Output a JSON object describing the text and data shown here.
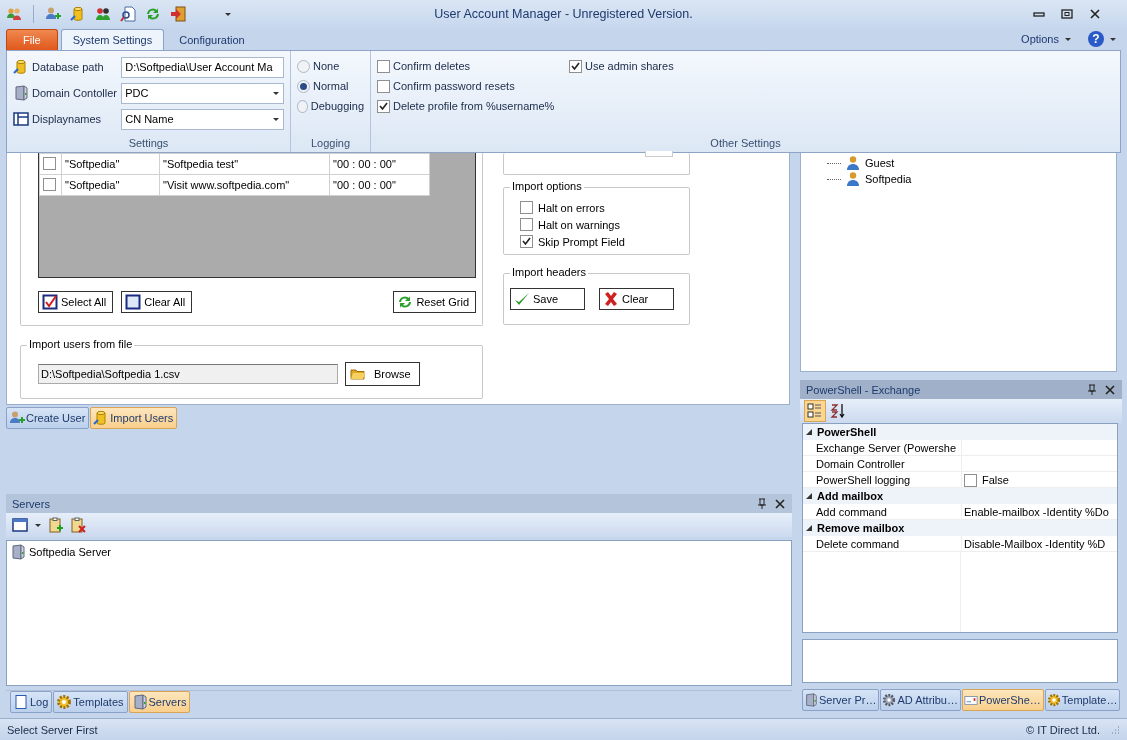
{
  "window": {
    "title": "User Account Manager - Unregistered Version."
  },
  "ribbon": {
    "tabs": [
      {
        "label": "File",
        "kind": "file",
        "selected": false
      },
      {
        "label": "System Settings",
        "kind": "page",
        "selected": true
      },
      {
        "label": "Configuration",
        "kind": "page",
        "selected": false
      }
    ],
    "options": "Options",
    "help": "?",
    "settings": {
      "caption": "Settings",
      "fields": [
        {
          "label": "Database path",
          "kind": "text",
          "value": "D:\\Softpedia\\User Account Ma"
        },
        {
          "label": "Domain Contoller",
          "kind": "dropdown",
          "value": "PDC"
        },
        {
          "label": "Displaynames",
          "kind": "dropdown",
          "value": "CN Name"
        }
      ]
    },
    "logging": {
      "caption": "Logging",
      "options": [
        {
          "label": "None",
          "selected": false
        },
        {
          "label": "Normal",
          "selected": true
        },
        {
          "label": "Debugging",
          "selected": false
        }
      ]
    },
    "other": {
      "caption": "Other Settings",
      "checks": [
        {
          "label": "Confirm deletes",
          "checked": false
        },
        {
          "label": "Confirm password resets",
          "checked": false
        },
        {
          "label": "Delete profile from %username%",
          "checked": true
        },
        {
          "label": "Use admin shares",
          "checked": true
        }
      ]
    }
  },
  "import": {
    "grid_rows": [
      {
        "checked": false,
        "cells": [
          "\"Softpedia\"",
          "\"Softpedia test\"",
          "\"00 : 00 : 00\""
        ]
      },
      {
        "checked": false,
        "cells": [
          "\"Softpedia\"",
          "\"Visit www.softpedia.com\"",
          "\"00 : 00 : 00\""
        ]
      }
    ],
    "grid_buttons": [
      {
        "label": "Select All",
        "kind": "checked-box"
      },
      {
        "label": "Clear All",
        "kind": "empty-box"
      },
      {
        "label": "Reset Grid",
        "kind": "refresh"
      }
    ],
    "import_options": {
      "title": "Import options",
      "items": [
        {
          "label": "Halt on errors",
          "checked": false
        },
        {
          "label": "Halt on warnings",
          "checked": false
        },
        {
          "label": "Skip Prompt Field",
          "checked": true
        }
      ]
    },
    "import_headers": {
      "title": "Import headers",
      "buttons": [
        {
          "label": "Save",
          "kind": "check"
        },
        {
          "label": "Clear",
          "kind": "cross"
        }
      ]
    },
    "file": {
      "title": "Import users from file",
      "value": "D:\\Softpedia\\Softpedia 1.csv",
      "button": "Browse"
    }
  },
  "doc_tabs": [
    {
      "label": "Create User",
      "kind": "add-user",
      "selected": false
    },
    {
      "label": "Import Users",
      "kind": "database",
      "selected": true
    }
  ],
  "servers": {
    "title": "Servers",
    "items": [
      {
        "label": "Softpedia Server"
      }
    ],
    "tabs": [
      {
        "label": "Log",
        "kind": "log",
        "selected": false
      },
      {
        "label": "Templates",
        "kind": "gear",
        "selected": false
      },
      {
        "label": "Servers",
        "kind": "server",
        "selected": true
      }
    ]
  },
  "user_tree": {
    "items": [
      {
        "label": "Guest"
      },
      {
        "label": "Softpedia"
      }
    ]
  },
  "powershell": {
    "title": "PowerShell - Exchange",
    "categories": [
      {
        "name": "PowerShell",
        "expanded": true,
        "rows": [
          {
            "name": "Exchange Server (Powershe",
            "kind": "text"
          },
          {
            "name": "Domain Controller",
            "kind": "text"
          },
          {
            "name": "PowerShell logging",
            "kind": "checkbox",
            "checked": false,
            "value": "False"
          }
        ]
      },
      {
        "name": "Add mailbox",
        "expanded": true,
        "rows": [
          {
            "name": "Add command",
            "kind": "text",
            "value": "Enable-mailbox -Identity %Do"
          }
        ]
      },
      {
        "name": "Remove mailbox",
        "expanded": true,
        "rows": [
          {
            "name": "Delete command",
            "kind": "text",
            "value": "Disable-Mailbox -Identity %D"
          }
        ]
      }
    ],
    "tabs": [
      {
        "label": "Server Pr…",
        "kind": "server",
        "selected": false
      },
      {
        "label": "AD Attribu…",
        "kind": "gear-grey",
        "selected": false
      },
      {
        "label": "PowerShe…",
        "kind": "card",
        "selected": true
      },
      {
        "label": "Template…",
        "kind": "gear",
        "selected": false
      }
    ]
  },
  "status_bar": {
    "left": "Select Server First",
    "right": "© IT Direct Ltd."
  }
}
